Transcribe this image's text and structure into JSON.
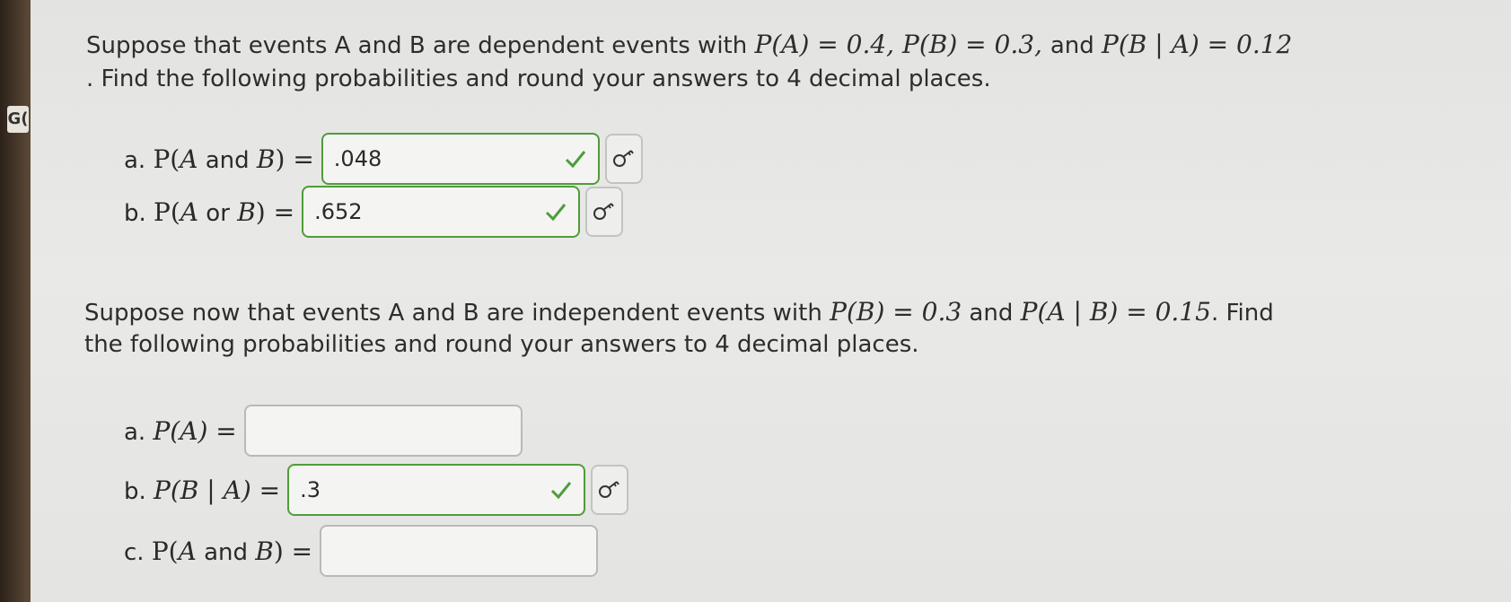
{
  "edge_label": "G(",
  "section1": {
    "intro_prefix": "Suppose that events A and B are dependent events with ",
    "pa": "P(A) = 0.4, ",
    "pb": "P(B) = 0.3, ",
    "and_word": "and ",
    "pba": "P(B | A) = 0.12",
    "line2": ". Find the following probabilities and round your answers to 4 decimal places.",
    "questions": [
      {
        "letter": "a.",
        "label_pre": "P(",
        "label_var": "A",
        "label_word": " and ",
        "label_var2": "B",
        "label_post": ") =",
        "value": ".048",
        "status": "correct"
      },
      {
        "letter": "b.",
        "label_pre": "P(",
        "label_var": "A",
        "label_word": " or ",
        "label_var2": "B",
        "label_post": ") =",
        "value": ".652",
        "status": "correct"
      }
    ]
  },
  "section2": {
    "intro_prefix": "Suppose now that events A and B are independent events with ",
    "pb": "P(B) = 0.3",
    "and_word": " and ",
    "pab": "P(A | B) = 0.15",
    "find": ". Find",
    "line2": "the following probabilities and round your answers to 4 decimal places.",
    "questions": [
      {
        "letter": "a.",
        "label": "P(A) =",
        "value": "",
        "status": "empty"
      },
      {
        "letter": "b.",
        "label": "P(B | A) =",
        "value": ".3",
        "status": "correct"
      },
      {
        "letter": "c.",
        "label_pre": "P(",
        "label_var": "A",
        "label_word": " and ",
        "label_var2": "B",
        "label_post": ") =",
        "value": "",
        "status": "empty"
      }
    ]
  },
  "icons": {
    "check": "checkmark-icon",
    "key": "key-icon"
  },
  "colors": {
    "correct": "#4f9c3a",
    "border_empty": "#b9b9b7"
  }
}
